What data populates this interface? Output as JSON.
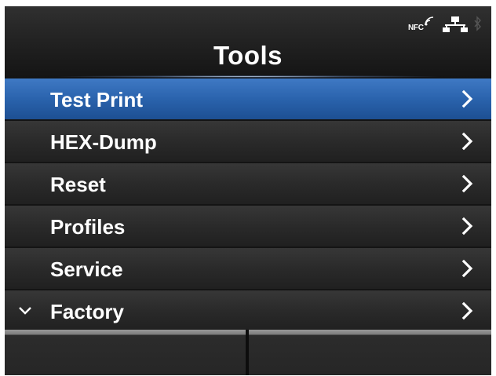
{
  "header": {
    "title": "Tools",
    "status_icons": {
      "nfc_label": "NFC",
      "nfc_icon": "nfc-icon",
      "network_icon": "wired-network-icon",
      "bluetooth_icon": "bluetooth-icon"
    }
  },
  "menu": {
    "items": [
      {
        "label": "Test Print",
        "selected": true,
        "icon": "chevron-right-icon"
      },
      {
        "label": "HEX-Dump",
        "selected": false,
        "icon": "chevron-right-icon"
      },
      {
        "label": "Reset",
        "selected": false,
        "icon": "chevron-right-icon"
      },
      {
        "label": "Profiles",
        "selected": false,
        "icon": "chevron-right-icon"
      },
      {
        "label": "Service",
        "selected": false,
        "icon": "chevron-right-icon"
      },
      {
        "label": "Factory",
        "selected": false,
        "icon": "chevron-right-icon",
        "scroll_indicator": "chevron-down-icon"
      }
    ]
  },
  "footer": {
    "left_softkey": "",
    "right_softkey": ""
  },
  "colors": {
    "screen_background": "#141414",
    "selected_row": "#2a63ad",
    "row": "#2a2a2a",
    "softkey_top": "#9a9a9a",
    "text": "#ffffff"
  }
}
